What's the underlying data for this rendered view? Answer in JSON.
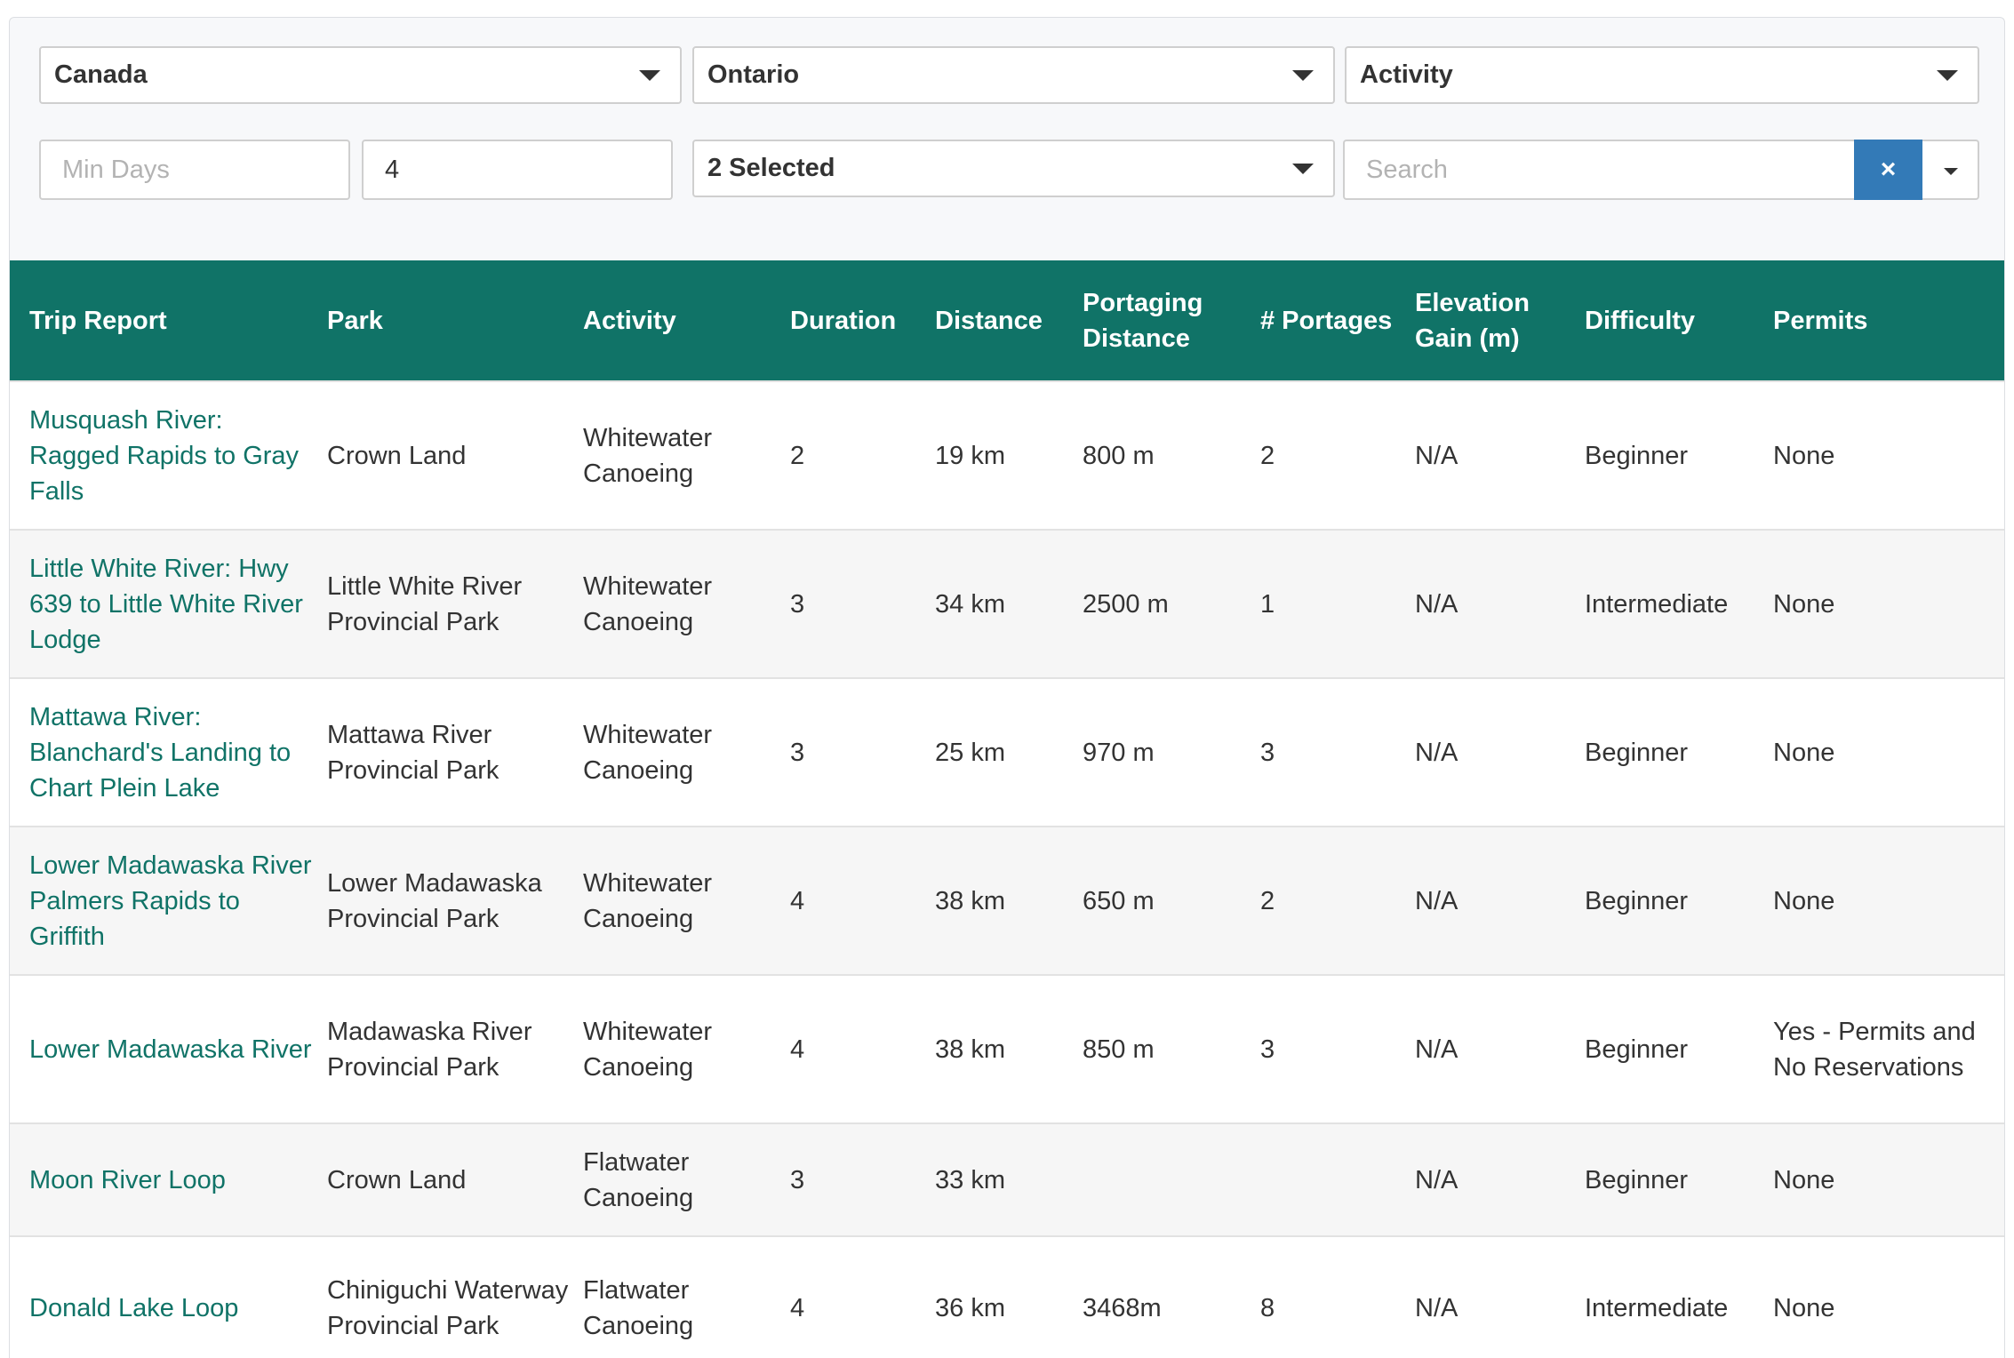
{
  "filters": {
    "country": "Canada",
    "province": "Ontario",
    "activity": "Activity",
    "min_days_placeholder": "Min Days",
    "max_days_value": "4",
    "selected": "2 Selected",
    "search_placeholder": "Search",
    "clear_symbol": "×"
  },
  "table": {
    "headers": [
      "Trip Report",
      "Park",
      "Activity",
      "Duration",
      "Distance",
      "Portaging Distance",
      "# Portages",
      "Elevation Gain (m)",
      "Difficulty",
      "Permits"
    ],
    "rows": [
      [
        "Musquash River: Ragged Rapids to Gray Falls",
        "Crown Land",
        "Whitewater Canoeing",
        "2",
        "19 km",
        "800 m",
        "2",
        "N/A",
        "Beginner",
        "None"
      ],
      [
        "Little White River: Hwy 639 to Little White River Lodge",
        "Little White River Provincial Park",
        "Whitewater Canoeing",
        "3",
        "34 km",
        "2500 m",
        "1",
        "N/A",
        "Intermediate",
        "None"
      ],
      [
        "Mattawa River: Blanchard's Landing to Chart Plein Lake",
        "Mattawa River Provincial Park",
        "Whitewater Canoeing",
        "3",
        "25 km",
        "970 m",
        "3",
        "N/A",
        "Beginner",
        "None"
      ],
      [
        "Lower Madawaska River Palmers Rapids to Griffith",
        "Lower Madawaska Provincial Park",
        "Whitewater Canoeing",
        "4",
        "38 km",
        "650 m",
        "2",
        "N/A",
        "Beginner",
        "None"
      ],
      [
        "Lower Madawaska River",
        "Madawaska River Provincial Park",
        "Whitewater Canoeing",
        "4",
        "38 km",
        "850 m",
        "3",
        "N/A",
        "Beginner",
        "Yes - Permits and No Reservations"
      ],
      [
        "Moon River Loop",
        "Crown Land",
        "Flatwater Canoeing",
        "3",
        "33 km",
        "",
        "",
        "N/A",
        "Beginner",
        "None"
      ],
      [
        "Donald Lake Loop",
        "Chiniguchi Waterway Provincial Park",
        "Flatwater Canoeing",
        "4",
        "36 km",
        "3468m",
        "8",
        "N/A",
        "Intermediate",
        "None"
      ]
    ]
  },
  "colors": {
    "header_bg": "#107367",
    "link": "#107367",
    "clear_button": "#337ab7"
  }
}
